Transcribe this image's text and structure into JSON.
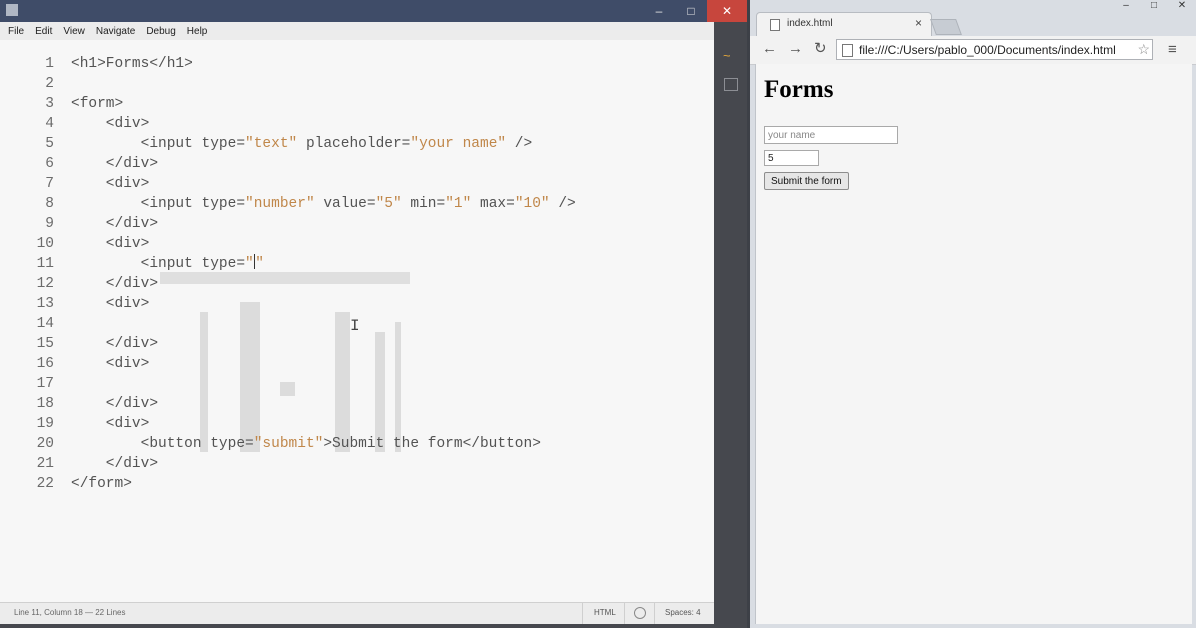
{
  "editor": {
    "window_controls": {
      "minimize": "–",
      "maximize": "□",
      "close": "✕"
    },
    "menu": [
      "File",
      "Edit",
      "View",
      "Navigate",
      "Debug",
      "Help"
    ],
    "code_lines": [
      {
        "n": "1",
        "html": "&lt;h1&gt;Forms&lt;/h1&gt;"
      },
      {
        "n": "2",
        "html": ""
      },
      {
        "n": "3",
        "html": "&lt;form&gt;"
      },
      {
        "n": "4",
        "html": "    &lt;div&gt;"
      },
      {
        "n": "5",
        "html": "        &lt;input type=<span class='str'>\"text\"</span> placeholder=<span class='str'>\"your name\"</span> /&gt;"
      },
      {
        "n": "6",
        "html": "    &lt;/div&gt;"
      },
      {
        "n": "7",
        "html": "    &lt;div&gt;"
      },
      {
        "n": "8",
        "html": "        &lt;input type=<span class='str'>\"number\"</span> value=<span class='str'>\"5\"</span> min=<span class='str'>\"1\"</span> max=<span class='str'>\"10\"</span> /&gt;"
      },
      {
        "n": "9",
        "html": "    &lt;/div&gt;"
      },
      {
        "n": "10",
        "html": "    &lt;div&gt;"
      },
      {
        "n": "11",
        "html": "        &lt;input type=<span class='str'>\"</span><span class='cursor'></span><span class='str'>\"</span>"
      },
      {
        "n": "12",
        "html": "    &lt;/div&gt;"
      },
      {
        "n": "13",
        "html": "    &lt;div&gt;"
      },
      {
        "n": "14",
        "html": ""
      },
      {
        "n": "15",
        "html": "    &lt;/div&gt;"
      },
      {
        "n": "16",
        "html": "    &lt;div&gt;"
      },
      {
        "n": "17",
        "html": ""
      },
      {
        "n": "18",
        "html": "    &lt;/div&gt;"
      },
      {
        "n": "19",
        "html": "    &lt;div&gt;"
      },
      {
        "n": "20",
        "html": "        &lt;button type=<span class='str'>\"submit\"</span>&gt;Submit the form&lt;/button&gt;"
      },
      {
        "n": "21",
        "html": "    &lt;/div&gt;"
      },
      {
        "n": "22",
        "html": "&lt;/form&gt;"
      }
    ],
    "status": {
      "position": "Line 11, Column 18 — 22 Lines",
      "language": "HTML",
      "indent": "Spaces: 4"
    },
    "icons": {
      "live_preview": "live-preview-icon",
      "extensions": "extensions-icon"
    }
  },
  "browser": {
    "tab_title": "index.html",
    "tab_close": "×",
    "window_controls": {
      "minimize": "–",
      "maximize": "□",
      "close": "✕"
    },
    "url": "file:///C:/Users/pablo_000/Documents/index.html",
    "nav": {
      "back": "←",
      "forward": "→",
      "reload": "↻",
      "menu": "≡",
      "star": "☆"
    },
    "page": {
      "heading": "Forms",
      "text_placeholder": "your name",
      "number_value": "5",
      "submit_label": "Submit the form"
    }
  },
  "colors": {
    "editor_title": "#3f4c68",
    "editor_bg": "#f7f7f7",
    "string": "#c0874a",
    "close_red": "#c7463d"
  }
}
